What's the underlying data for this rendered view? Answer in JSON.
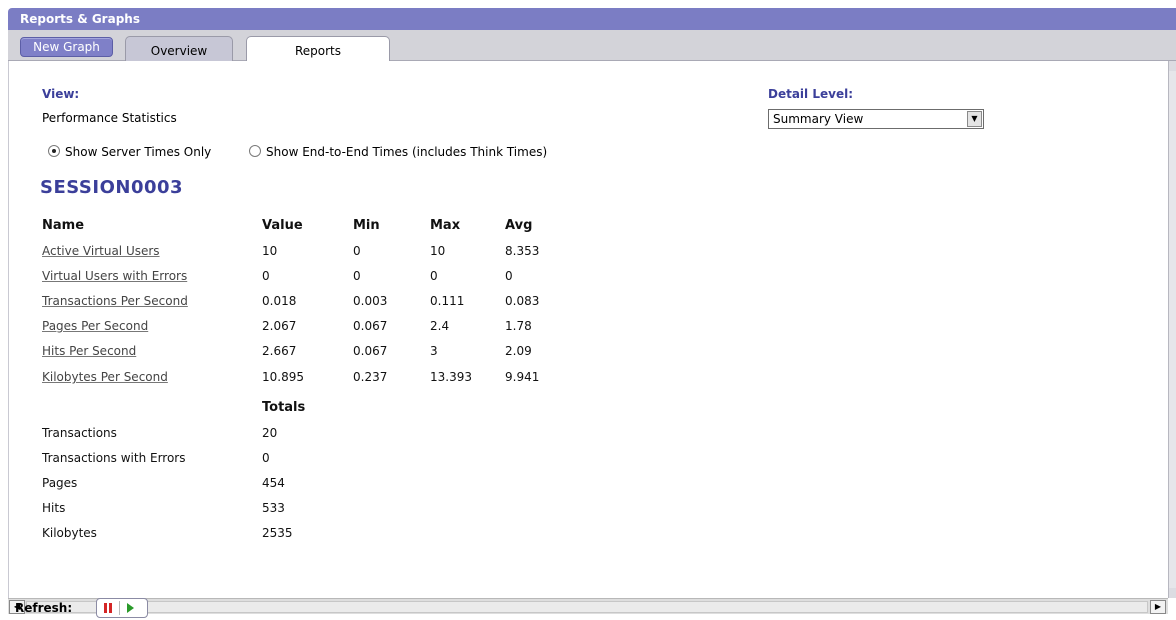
{
  "window": {
    "title": "Reports & Graphs"
  },
  "toolbar": {
    "new_graph_label": "New Graph"
  },
  "tabs": [
    {
      "label": "Overview"
    },
    {
      "label": "Reports"
    }
  ],
  "view": {
    "label": "View:",
    "value": "Performance Statistics",
    "radio_server": "Show Server Times Only",
    "radio_e2e": "Show End-to-End Times (includes Think Times)"
  },
  "detail": {
    "label": "Detail Level:",
    "selected": "Summary View"
  },
  "session": {
    "name": "SESSION0003"
  },
  "table": {
    "headers": [
      "Name",
      "Value",
      "Min",
      "Max",
      "Avg"
    ],
    "rows": [
      {
        "name": "Active Virtual Users",
        "value": "10",
        "min": "0",
        "max": "10",
        "avg": "8.353"
      },
      {
        "name": "Virtual Users with Errors",
        "value": "0",
        "min": "0",
        "max": "0",
        "avg": "0"
      },
      {
        "name": "Transactions Per Second",
        "value": "0.018",
        "min": "0.003",
        "max": "0.111",
        "avg": "0.083"
      },
      {
        "name": "Pages Per Second",
        "value": "2.067",
        "min": "0.067",
        "max": "2.4",
        "avg": "1.78"
      },
      {
        "name": "Hits Per Second",
        "value": "2.667",
        "min": "0.067",
        "max": "3",
        "avg": "2.09"
      },
      {
        "name": "Kilobytes Per Second",
        "value": "10.895",
        "min": "0.237",
        "max": "13.393",
        "avg": "9.941"
      }
    ]
  },
  "totals": {
    "header": "Totals",
    "rows": [
      {
        "name": "Transactions",
        "value": "20"
      },
      {
        "name": "Transactions with Errors",
        "value": "0"
      },
      {
        "name": "Pages",
        "value": "454"
      },
      {
        "name": "Hits",
        "value": "533"
      },
      {
        "name": "Kilobytes",
        "value": "2535"
      }
    ]
  },
  "refresh": {
    "label": "Refresh:"
  }
}
